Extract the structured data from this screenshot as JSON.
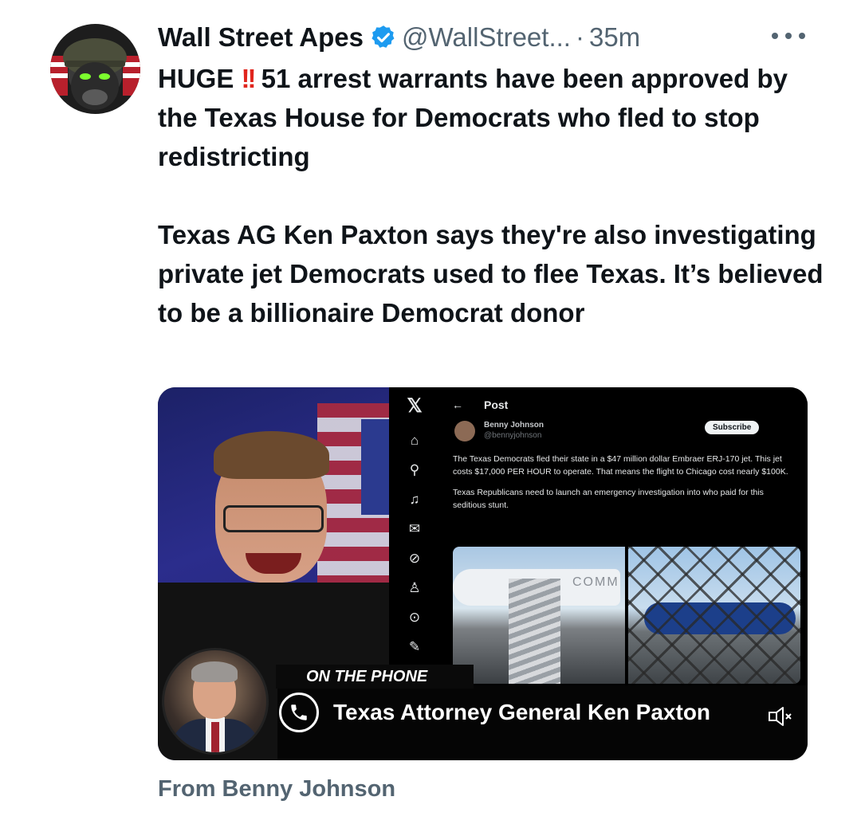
{
  "author": {
    "name": "Wall Street Apes",
    "handle": "@WallStreet...",
    "separator": "·",
    "time": "35m",
    "avatar_icon": "gorilla-helmet-avatar",
    "verified_icon": "verified-badge-icon"
  },
  "tweet": {
    "line_prefix": "HUGE",
    "emoji": "!!",
    "paragraph1_rest": "51 arrest warrants have been approved by the Texas House for Democrats who fled to stop redistricting",
    "paragraph2": "Texas AG Ken Paxton says they're also investigating private jet Democrats used to flee Texas. It’s believed to be a billionaire Democrat donor"
  },
  "media": {
    "sidebar_icons": [
      "x-logo-icon",
      "home-icon",
      "search-icon",
      "bell-icon",
      "mail-icon",
      "grok-icon",
      "profile-icon",
      "more-icon",
      "compose-icon"
    ],
    "embedded_post": {
      "back": "←",
      "title": "Post",
      "user": "Benny Johnson",
      "handle": "@bennyjohnson",
      "subscribe": "Subscribe",
      "body1": "The Texas Democrats fled their state in a $47 million dollar Embraer ERJ-170 jet. This jet costs $17,000 PER HOUR to operate. That means the flight to Chicago cost nearly $100K.",
      "body2": "Texas Republicans need to launch an emergency investigation into who paid for this seditious stunt.",
      "photo_label": "COMM"
    },
    "on_the_phone": "ON THE PHONE",
    "caption": "Texas Attorney General Ken Paxton"
  },
  "attribution": "From Benny Johnson",
  "colors": {
    "verified": "#1d9bf0",
    "emoji_red": "#e0251d",
    "secondary_text": "#536471"
  }
}
